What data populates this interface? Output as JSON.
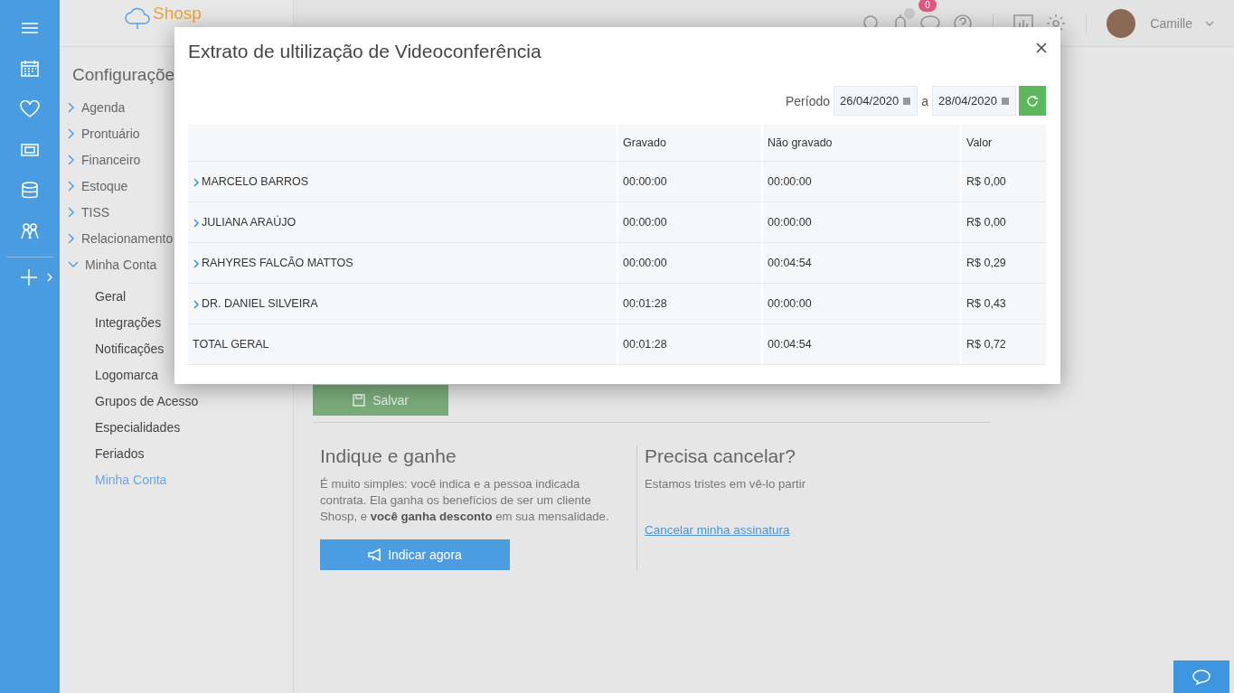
{
  "header": {
    "logo": "Shosp",
    "notification_count": "0",
    "user_name": "Camille"
  },
  "settings_nav": {
    "title": "Configuraçõe",
    "items": [
      {
        "label": "Agenda",
        "expanded": false
      },
      {
        "label": "Prontuário",
        "expanded": false
      },
      {
        "label": "Financeiro",
        "expanded": false
      },
      {
        "label": "Estoque",
        "expanded": false
      },
      {
        "label": "TISS",
        "expanded": false
      },
      {
        "label": "Relacionamento",
        "expanded": false
      },
      {
        "label": "Minha Conta",
        "expanded": true,
        "children": [
          {
            "label": "Geral",
            "selected": false
          },
          {
            "label": "Integrações",
            "selected": false
          },
          {
            "label": "Notificações",
            "selected": false
          },
          {
            "label": "Logomarca",
            "selected": false
          },
          {
            "label": "Grupos de Acesso",
            "selected": false
          },
          {
            "label": "Especialidades",
            "selected": false
          },
          {
            "label": "Feriados",
            "selected": false
          },
          {
            "label": "Minha Conta",
            "selected": true
          }
        ]
      }
    ]
  },
  "account": {
    "save_button": "Salvar",
    "referral": {
      "title": "Indique e ganhe",
      "text": "É muito simples: você indica e a pessoa indicada contrata. Ela ganha os benefícios de ser um cliente Shosp, e **você ganha desconto** em sua mensalidade.",
      "button": "Indicar agora"
    },
    "cancel": {
      "title": "Precisa cancelar?",
      "text": "Estamos tristes em vê-lo partir",
      "link": "Cancelar minha assinatura"
    }
  },
  "modal": {
    "title": "Extrato de ultilização de Videoconferência",
    "period_label": "Período",
    "date_from": "26/04/2020",
    "date_separator": "a",
    "date_to": "28/04/2020",
    "table": {
      "columns": [
        "Gravado",
        "Não gravado",
        "Valor"
      ],
      "rows": [
        {
          "name": "MARCELO BARROS",
          "expandable": true,
          "recorded": "00:00:00",
          "not_recorded": "00:00:00",
          "value": "R$ 0,00"
        },
        {
          "name": "JULIANA ARAÚJO",
          "expandable": true,
          "recorded": "00:00:00",
          "not_recorded": "00:00:00",
          "value": "R$ 0,00"
        },
        {
          "name": "RAHYRES FALCÃO MATTOS",
          "expandable": true,
          "recorded": "00:00:00",
          "not_recorded": "00:04:54",
          "value": "R$ 0,29"
        },
        {
          "name": "DR. DANIEL SILVEIRA",
          "expandable": true,
          "recorded": "00:01:28",
          "not_recorded": "00:00:00",
          "value": "R$ 0,43"
        },
        {
          "name": "TOTAL GERAL",
          "expandable": false,
          "recorded": "00:01:28",
          "not_recorded": "00:04:54",
          "value": "R$ 0,72"
        }
      ]
    }
  }
}
